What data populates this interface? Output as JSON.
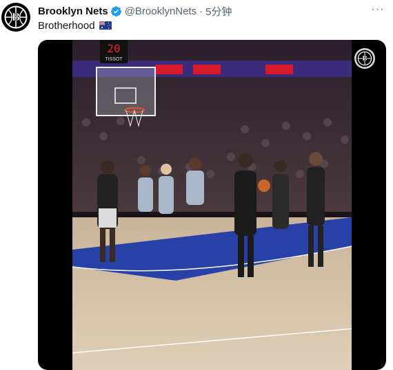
{
  "tweet": {
    "display_name": "Brooklyn Nets",
    "handle": "@BrooklynNets",
    "separator": "·",
    "time": "5分钟",
    "text": "Brotherhood",
    "more_label": "···"
  },
  "media": {
    "scoreboard": "20",
    "scoreboard_sponsor": "TISSOT"
  },
  "colors": {
    "verified": "#1d9bf0",
    "court_blue": "#1f3aa8",
    "arena_red": "#d8192a"
  },
  "icons": {
    "avatar": "brooklyn-nets-logo",
    "verified": "verified-badge-icon",
    "flag": "australia-flag-icon",
    "more": "more-options-icon",
    "overlay": "nets-logo-watermark"
  }
}
